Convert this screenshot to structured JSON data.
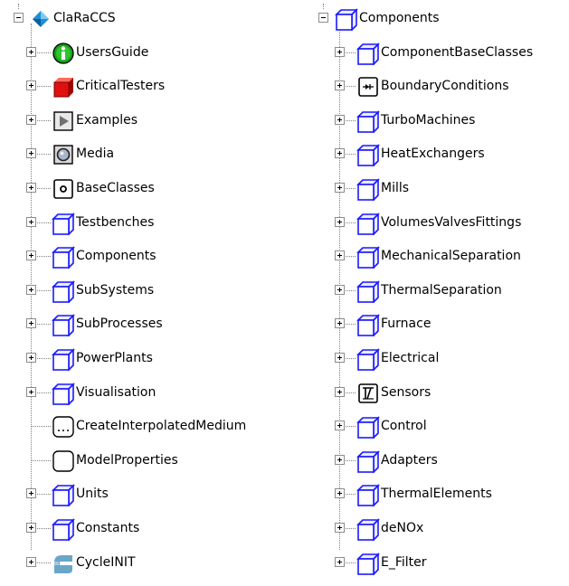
{
  "left_tree": {
    "root": {
      "label": "ClaRaCCS",
      "icon": "package-root-icon",
      "expanded": true
    },
    "items": [
      {
        "label": "UsersGuide",
        "icon": "info-icon",
        "expandable": true
      },
      {
        "label": "CriticalTesters",
        "icon": "red-cube-icon",
        "expandable": true
      },
      {
        "label": "Examples",
        "icon": "play-icon",
        "expandable": true
      },
      {
        "label": "Media",
        "icon": "media-icon",
        "expandable": true
      },
      {
        "label": "BaseClasses",
        "icon": "base-classes-icon",
        "expandable": true
      },
      {
        "label": "Testbenches",
        "icon": "package-icon",
        "expandable": true
      },
      {
        "label": "Components",
        "icon": "package-icon",
        "expandable": true
      },
      {
        "label": "SubSystems",
        "icon": "package-icon",
        "expandable": true
      },
      {
        "label": "SubProcesses",
        "icon": "package-icon",
        "expandable": true
      },
      {
        "label": "PowerPlants",
        "icon": "package-icon",
        "expandable": true
      },
      {
        "label": "Visualisation",
        "icon": "package-icon",
        "expandable": true
      },
      {
        "label": "CreateInterpolatedMedium",
        "icon": "function-icon",
        "expandable": false
      },
      {
        "label": "ModelProperties",
        "icon": "record-icon",
        "expandable": false
      },
      {
        "label": "Units",
        "icon": "package-icon",
        "expandable": true
      },
      {
        "label": "Constants",
        "icon": "package-icon",
        "expandable": true
      },
      {
        "label": "CycleINIT",
        "icon": "cycle-icon",
        "expandable": true
      }
    ]
  },
  "right_tree": {
    "root": {
      "label": "Components",
      "icon": "package-icon",
      "expanded": true
    },
    "items": [
      {
        "label": "ComponentBaseClasses",
        "icon": "package-icon",
        "expandable": true
      },
      {
        "label": "BoundaryConditions",
        "icon": "boundary-icon",
        "expandable": true
      },
      {
        "label": "TurboMachines",
        "icon": "package-icon",
        "expandable": true
      },
      {
        "label": "HeatExchangers",
        "icon": "package-icon",
        "expandable": true
      },
      {
        "label": "Mills",
        "icon": "package-icon",
        "expandable": true
      },
      {
        "label": "VolumesValvesFittings",
        "icon": "package-icon",
        "expandable": true
      },
      {
        "label": "MechanicalSeparation",
        "icon": "package-icon",
        "expandable": true
      },
      {
        "label": "ThermalSeparation",
        "icon": "package-icon",
        "expandable": true
      },
      {
        "label": "Furnace",
        "icon": "package-icon",
        "expandable": true
      },
      {
        "label": "Electrical",
        "icon": "package-icon",
        "expandable": true
      },
      {
        "label": "Sensors",
        "icon": "sensor-icon",
        "expandable": true
      },
      {
        "label": "Control",
        "icon": "package-icon",
        "expandable": true
      },
      {
        "label": "Adapters",
        "icon": "package-icon",
        "expandable": true
      },
      {
        "label": "ThermalElements",
        "icon": "package-icon",
        "expandable": true
      },
      {
        "label": "deNOx",
        "icon": "package-icon",
        "expandable": true
      },
      {
        "label": "E_Filter",
        "icon": "package-icon",
        "expandable": true
      }
    ]
  },
  "colors": {
    "package_blue": "#1a1aff",
    "package_face": "#ececff",
    "tree_line": "#808080",
    "info_green": "#1a9e1a",
    "red_cube": "#e01010"
  }
}
